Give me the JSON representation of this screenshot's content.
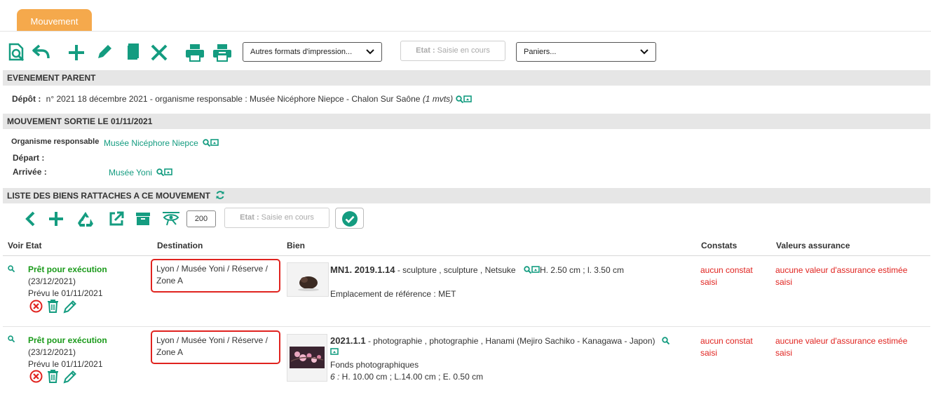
{
  "tab": {
    "label": "Mouvement"
  },
  "toolbar": {
    "print_formats": "Autres formats d'impression...",
    "etat_label": "Etat :",
    "etat_value": "Saisie en cours",
    "paniers": "Paniers..."
  },
  "parent": {
    "section_title": "EVENEMENT PARENT",
    "depot_label": "Dépôt :",
    "depot_text": "n° 2021 18 décembre 2021 - organisme responsable : Musée Nicéphore Niepce - Chalon Sur Saône",
    "depot_count": "(1 mvts)"
  },
  "mouvement": {
    "section_title": "MOUVEMENT SORTIE LE 01/11/2021",
    "org_label": "Organisme responsable",
    "org_value": "Musée Nicéphore Niepce",
    "depart_label": "Départ :",
    "arrivee_label": "Arrivée :",
    "arrivee_value": "Musée Yoni"
  },
  "liste": {
    "section_title": "LISTE DES BIENS RATTACHES A CE MOUVEMENT",
    "page_size": "200",
    "etat_label": "Etat :",
    "etat_value": "Saisie en cours"
  },
  "columns": {
    "voir_etat": "Voir Etat",
    "destination": "Destination",
    "bien": "Bien",
    "constats": "Constats",
    "valeurs": "Valeurs assurance"
  },
  "rows": [
    {
      "status": "Prêt pour exécution",
      "date": "(23/12/2021)",
      "prevu": "Prévu le 01/11/2021",
      "destination": "Lyon / Musée Yoni / Réserve / Zone A",
      "bien_id": "MN1. 2019.1.14",
      "bien_desc": " - sculpture , sculpture , Netsuke",
      "bien_dims": "H. 2.50 cm ; l. 3.50 cm",
      "bien_line2": "Emplacement de référence : MET",
      "bien_line3": "",
      "constats": "aucun constat saisi",
      "valeurs": "aucune valeur d'assurance estimée saisi"
    },
    {
      "status": "Prêt pour exécution",
      "date": "(23/12/2021)",
      "prevu": "Prévu le 01/11/2021",
      "destination": "Lyon / Musée Yoni / Réserve / Zone A",
      "bien_id": "2021.1.1",
      "bien_desc": " - photographie , photographie , Hanami (Mejiro Sachiko - Kanagawa - Japon)",
      "bien_dims": "",
      "bien_line2": "Fonds photographiques",
      "bien_line3_italic": "6 :",
      "bien_line3": " H. 10.00 cm ; L.14.00 cm ; E. 0.50 cm",
      "constats": "aucun constat saisi",
      "valeurs": "aucune valeur d'assurance estimée saisi"
    }
  ],
  "colors": {
    "accent": "#149c80",
    "tab": "#f5a94c",
    "status": "#1a9a1a",
    "alert": "#e0231f"
  }
}
